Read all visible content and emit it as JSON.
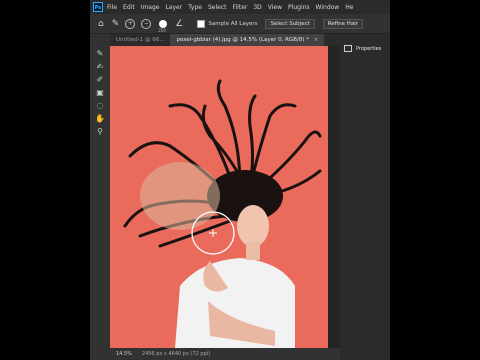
{
  "app": {
    "logo": "Ps"
  },
  "menu": [
    "File",
    "Edit",
    "Image",
    "Layer",
    "Type",
    "Select",
    "Filter",
    "3D",
    "View",
    "Plugins",
    "Window",
    "He"
  ],
  "options": {
    "brush_size": "250",
    "sample_all_layers": "Sample All Layers",
    "select_subject": "Select Subject",
    "refine_hair": "Refine Hair"
  },
  "tabs": [
    {
      "label": "Untitled-1 @ 66...",
      "active": false
    },
    {
      "label": "pexel-gbbiar (4).jpg @ 14.5% (Layer 0, RGB/8) *",
      "active": true
    }
  ],
  "tools": [
    "quick-selection-icon",
    "brush-icon",
    "mixer-brush-icon",
    "eraser-icon",
    "lasso-icon",
    "hand-icon",
    "zoom-icon"
  ],
  "status": {
    "zoom": "14.5%",
    "docinfo": "2456 px x 4640 px (72 ppi)"
  },
  "panel": {
    "title": "Properties"
  },
  "colors": {
    "background": "#ea6a5c",
    "ui_dark": "#323232",
    "accent": "#31a8ff"
  }
}
